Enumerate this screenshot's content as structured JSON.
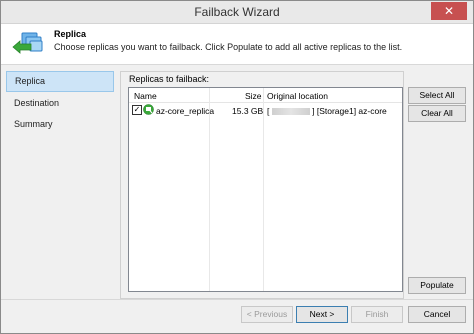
{
  "window": {
    "title": "Failback Wizard",
    "close_glyph": "✕"
  },
  "header": {
    "title": "Replica",
    "subtitle": "Choose replicas you want to failback. Click Populate to add all active replicas to the list.",
    "icon": "replica-wizard-icon"
  },
  "steps": [
    {
      "label": "Replica",
      "active": true
    },
    {
      "label": "Destination",
      "active": false
    },
    {
      "label": "Summary",
      "active": false
    }
  ],
  "replicas_panel": {
    "label": "Replicas to failback:",
    "columns": {
      "name": "Name",
      "size": "Size",
      "location": "Original location"
    },
    "rows": [
      {
        "checked": true,
        "check_glyph": "✓",
        "name": "az-core_replica",
        "size": "15.3 GB",
        "location_open": "[",
        "location": "] [Storage1] az-core"
      }
    ]
  },
  "side_buttons": {
    "select_all": "Select All",
    "clear_all": "Clear All",
    "populate": "Populate"
  },
  "footer": {
    "previous": "< Previous",
    "next": "Next >",
    "finish": "Finish",
    "cancel": "Cancel"
  },
  "colors": {
    "active_step": "#cde4f7",
    "close_button": "#c75050",
    "icon_green": "#3aa83a",
    "icon_blue": "#2f7fc7"
  }
}
